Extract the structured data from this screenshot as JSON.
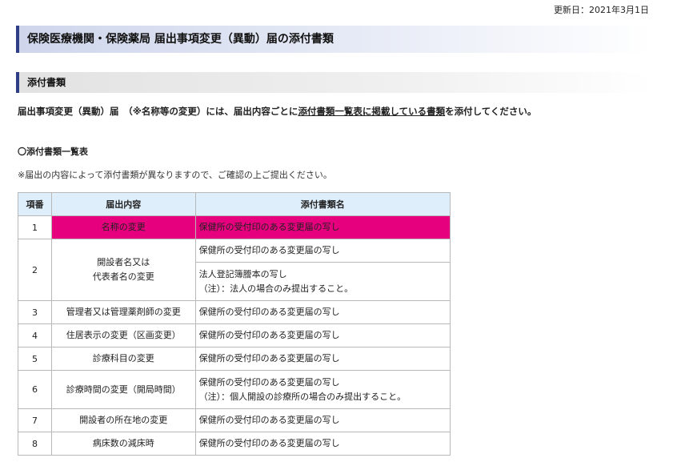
{
  "updated": "更新日：2021年3月1日",
  "page_title": "保険医療機関・保険薬局 届出事項変更（異動）届の添付書類",
  "section_title": "添付書類",
  "intro": {
    "before": "届出事項変更（異動）届　（※名称等の変更）には、届出内容ごとに",
    "link": "添付書類一覧表に掲載している書類",
    "after": "を添付してください。"
  },
  "list_heading": "〇添付書類一覧表",
  "note": "※届出の内容によって添付書類が異なりますので、ご確認の上ご提出ください。",
  "table": {
    "headers": [
      "項番",
      "届出内容",
      "添付書類名"
    ],
    "rows": [
      {
        "no": "1",
        "content": "名称の変更",
        "docs": [
          "保健所の受付印のある変更届の写し"
        ]
      },
      {
        "no": "2",
        "content_lines": [
          "開設者名又は",
          "代表者名の変更"
        ],
        "docs": [
          "保健所の受付印のある変更届の写し"
        ],
        "docs2": [
          "法人登記簿謄本の写し",
          "（注）：法人の場合のみ提出すること。"
        ]
      },
      {
        "no": "3",
        "content": "管理者又は管理薬剤師の変更",
        "docs": [
          "保健所の受付印のある変更届の写し"
        ]
      },
      {
        "no": "4",
        "content": "住居表示の変更（区画変更）",
        "docs": [
          "保健所の受付印のある変更届の写し"
        ]
      },
      {
        "no": "5",
        "content": "診療科目の変更",
        "docs": [
          "保健所の受付印のある変更届の写し"
        ]
      },
      {
        "no": "6",
        "content": "診療時間の変更（開局時間）",
        "docs": [
          "保健所の受付印のある変更届の写し",
          "（注）：個人開設の診療所の場合のみ提出すること。"
        ]
      },
      {
        "no": "7",
        "content": "開設者の所在地の変更",
        "docs": [
          "保健所の受付印のある変更届の写し"
        ]
      },
      {
        "no": "8",
        "content": "病床数の減床時",
        "docs": [
          "保健所の受付印のある変更届の写し"
        ]
      }
    ]
  },
  "colors": {
    "highlight": "#e6007e",
    "header_bg": "#dfeefb",
    "title_border": "#2d3e86"
  }
}
